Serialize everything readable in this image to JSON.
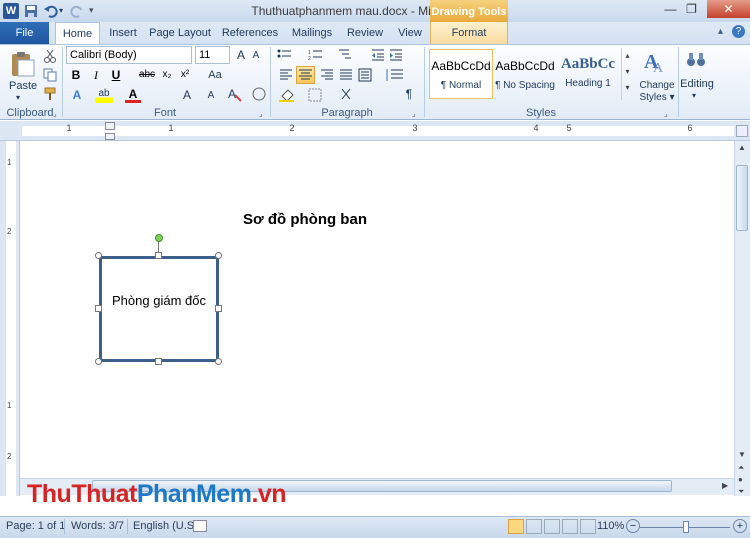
{
  "title_bar": {
    "document_title": "Thuthuatphanmem mau.docx - Microsoft Word",
    "contextual_tab": "Drawing Tools",
    "logo_letter": "W",
    "minimize": "—",
    "maximize": "❐",
    "close": "✕"
  },
  "tabs": [
    {
      "label": "File"
    },
    {
      "label": "Home"
    },
    {
      "label": "Insert"
    },
    {
      "label": "Page Layout"
    },
    {
      "label": "References"
    },
    {
      "label": "Mailings"
    },
    {
      "label": "Review"
    },
    {
      "label": "View"
    },
    {
      "label": "Format"
    }
  ],
  "ribbon": {
    "clipboard": {
      "paste_label": "Paste",
      "group_label": "Clipboard"
    },
    "font": {
      "font_name": "Calibri (Body)",
      "font_size": "11",
      "group_label": "Font",
      "bold": "B",
      "italic": "I",
      "underline": "U",
      "strike": "abc",
      "subscript": "x₂",
      "superscript": "x²",
      "text_effects": "A",
      "highlight": "ab",
      "font_color": "A",
      "grow": "A",
      "shrink": "A",
      "change_case": "Aa",
      "clear_format": "A"
    },
    "paragraph": {
      "group_label": "Paragraph",
      "pilcrow": "¶"
    },
    "styles": {
      "group_label": "Styles",
      "items": [
        {
          "sample": "AaBbCcDd",
          "name": "¶ Normal"
        },
        {
          "sample": "AaBbCcDd",
          "name": "¶ No Spacing"
        },
        {
          "sample": "AaBbCc",
          "name": "Heading 1"
        }
      ],
      "change_styles": "Change Styles",
      "change_styles_line1": "Change",
      "change_styles_line2": "Styles"
    },
    "editing": {
      "label": "Editing"
    }
  },
  "ruler": {
    "h_numbers": [
      "1",
      "1",
      "2",
      "3",
      "4",
      "5",
      "6"
    ],
    "v_numbers": [
      "1",
      "2",
      "1",
      "2"
    ]
  },
  "document": {
    "heading": "Sơ đồ phòng ban",
    "shape_text": "Phòng giám đốc"
  },
  "watermark": {
    "part1": "ThuThuat",
    "part2": "PhanMem",
    "part3": ".vn"
  },
  "status_bar": {
    "page": "Page: 1 of 1",
    "words": "Words: 3/7",
    "language": "English (U.S.)",
    "zoom": "110%",
    "zoom_out": "−",
    "zoom_in": "+"
  },
  "colors": {
    "file_tab": "#2f6eb8",
    "drawing_tools": "#e9a93a",
    "shape_border": "#3c5f8c",
    "watermark_red": "#d82323",
    "watermark_blue": "#1e78c8"
  }
}
